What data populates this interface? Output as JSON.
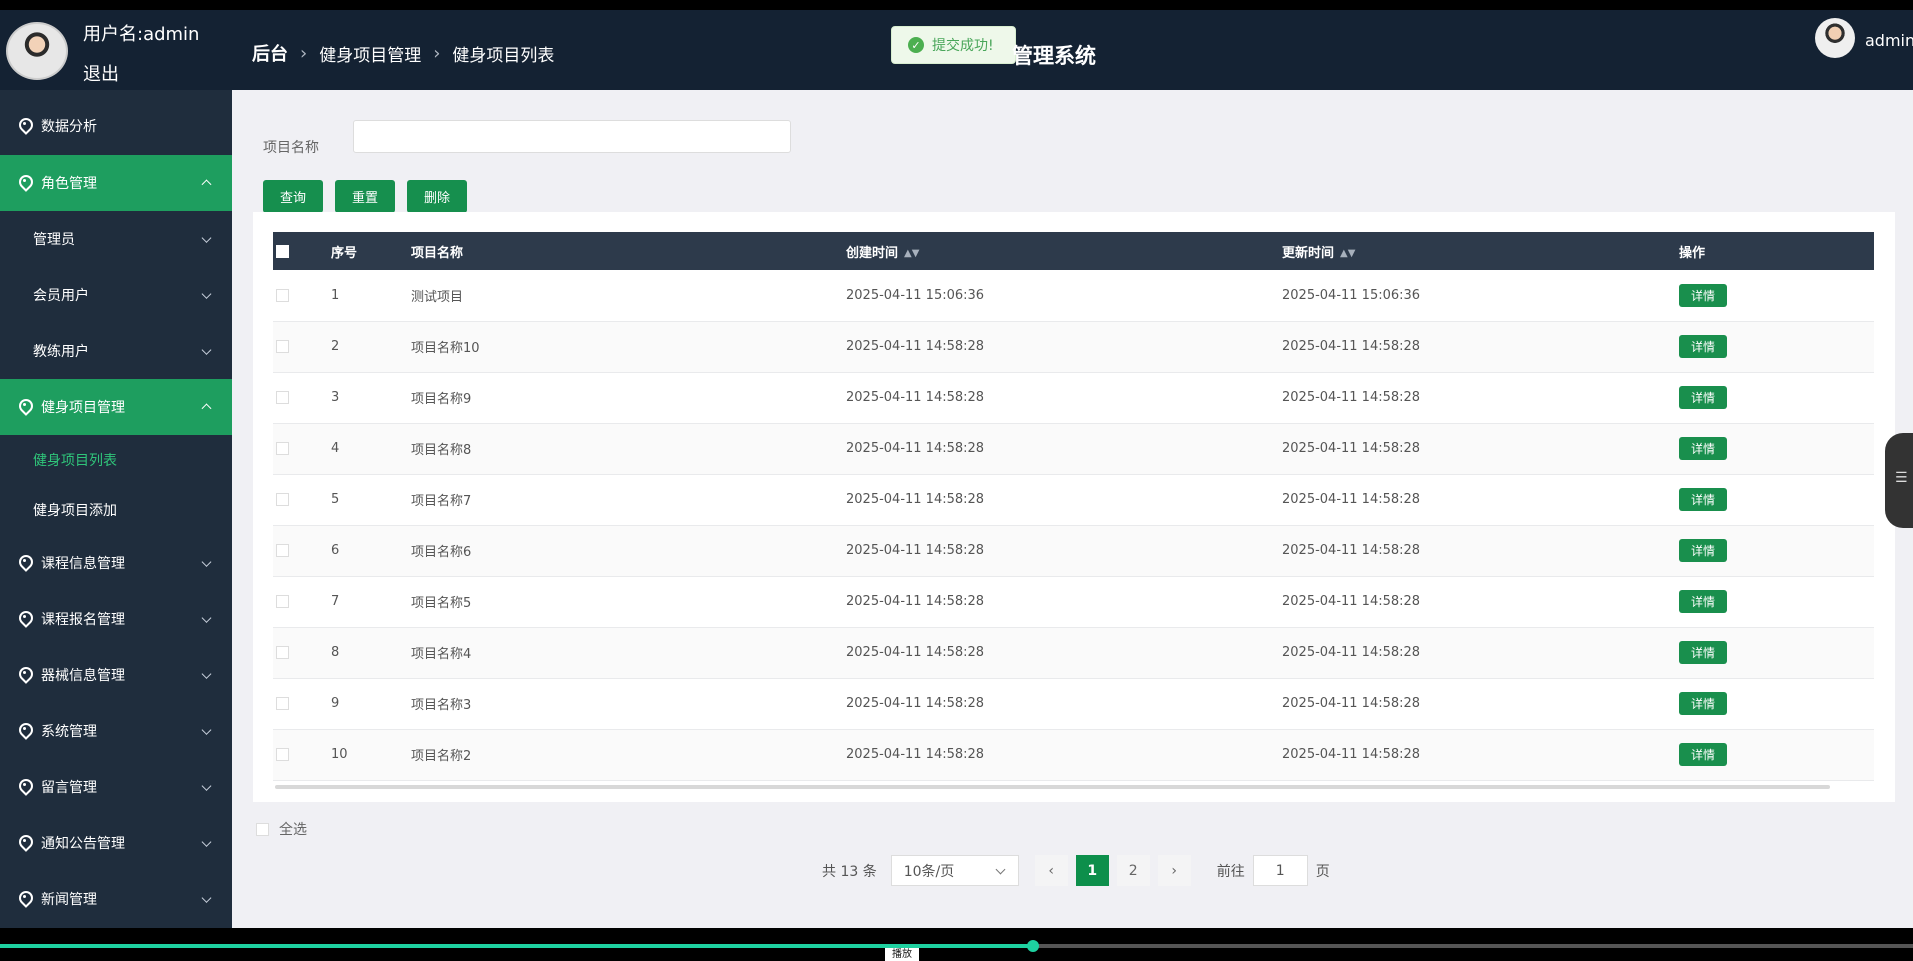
{
  "header": {
    "user_label": "用户名:admin",
    "logout": "退出",
    "breadcrumb": [
      "后台",
      "健身项目管理",
      "健身项目列表"
    ],
    "toast": "提交成功!",
    "system_title": "管理系统",
    "current_user": "admin"
  },
  "sidebar": {
    "items": [
      {
        "label": "数据分析"
      },
      {
        "label": "角色管理"
      },
      {
        "label": "管理员"
      },
      {
        "label": "会员用户"
      },
      {
        "label": "教练用户"
      },
      {
        "label": "健身项目管理"
      },
      {
        "label": "健身项目列表"
      },
      {
        "label": "健身项目添加"
      },
      {
        "label": "课程信息管理"
      },
      {
        "label": "课程报名管理"
      },
      {
        "label": "器械信息管理"
      },
      {
        "label": "系统管理"
      },
      {
        "label": "留言管理"
      },
      {
        "label": "通知公告管理"
      },
      {
        "label": "新闻管理"
      }
    ]
  },
  "search": {
    "label": "项目名称",
    "value": "",
    "placeholder": ""
  },
  "actions": {
    "query": "查询",
    "reset": "重置",
    "delete": "删除"
  },
  "table": {
    "columns": [
      "序号",
      "项目名称",
      "创建时间",
      "更新时间",
      "操作"
    ],
    "rows": [
      {
        "index": "1",
        "name": "测试项目",
        "created": "2025-04-11 15:06:36",
        "updated": "2025-04-11 15:06:36",
        "action": "详情"
      },
      {
        "index": "2",
        "name": "项目名称10",
        "created": "2025-04-11 14:58:28",
        "updated": "2025-04-11 14:58:28",
        "action": "详情"
      },
      {
        "index": "3",
        "name": "项目名称9",
        "created": "2025-04-11 14:58:28",
        "updated": "2025-04-11 14:58:28",
        "action": "详情"
      },
      {
        "index": "4",
        "name": "项目名称8",
        "created": "2025-04-11 14:58:28",
        "updated": "2025-04-11 14:58:28",
        "action": "详情"
      },
      {
        "index": "5",
        "name": "项目名称7",
        "created": "2025-04-11 14:58:28",
        "updated": "2025-04-11 14:58:28",
        "action": "详情"
      },
      {
        "index": "6",
        "name": "项目名称6",
        "created": "2025-04-11 14:58:28",
        "updated": "2025-04-11 14:58:28",
        "action": "详情"
      },
      {
        "index": "7",
        "name": "项目名称5",
        "created": "2025-04-11 14:58:28",
        "updated": "2025-04-11 14:58:28",
        "action": "详情"
      },
      {
        "index": "8",
        "name": "项目名称4",
        "created": "2025-04-11 14:58:28",
        "updated": "2025-04-11 14:58:28",
        "action": "详情"
      },
      {
        "index": "9",
        "name": "项目名称3",
        "created": "2025-04-11 14:58:28",
        "updated": "2025-04-11 14:58:28",
        "action": "详情"
      },
      {
        "index": "10",
        "name": "项目名称2",
        "created": "2025-04-11 14:58:28",
        "updated": "2025-04-11 14:58:28",
        "action": "详情"
      }
    ]
  },
  "footer": {
    "select_all": "全选",
    "total": "共 13 条",
    "page_size": "10条/页",
    "prev": "‹",
    "page_1": "1",
    "page_2": "2",
    "next": "›",
    "goto": "前往",
    "jump_value": "1",
    "page_suffix": "页"
  },
  "video": {
    "label": "播放",
    "progress": 0.54
  },
  "colors": {
    "sidebar": "#1f2d3d",
    "accent": "#198f4d",
    "header": "#142233"
  }
}
